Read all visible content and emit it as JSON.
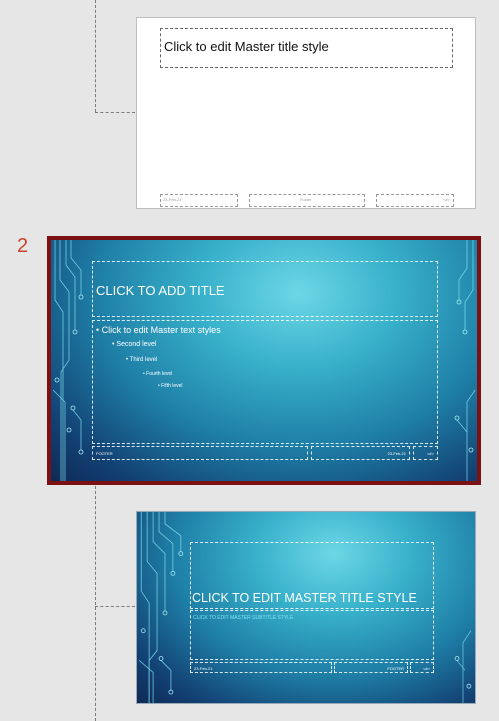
{
  "accent_color": "#7b1113",
  "slide_number_color": "#c8442a",
  "layout_1": {
    "title_placeholder": "Click to edit Master title style",
    "footer_date": "23-Feb-21",
    "footer_text": "Footer",
    "footer_page": "<#>"
  },
  "master": {
    "number": "2",
    "title_placeholder": "CLICK TO ADD TITLE",
    "text_levels": [
      "Click to edit Master text styles",
      "Second level",
      "Third level",
      "Fourth level",
      "Fifth level"
    ],
    "footer_text": "FOOTER",
    "footer_date": "23-Feb-21",
    "footer_page": "<#>"
  },
  "layout_2": {
    "title_placeholder": "CLICK TO EDIT MASTER TITLE STYLE",
    "subtitle_placeholder": "CLICK TO EDIT MASTER SUBTITLE STYLE",
    "footer_date": "23-Feb-21",
    "footer_text": "FOOTER",
    "footer_page": "<#>"
  }
}
